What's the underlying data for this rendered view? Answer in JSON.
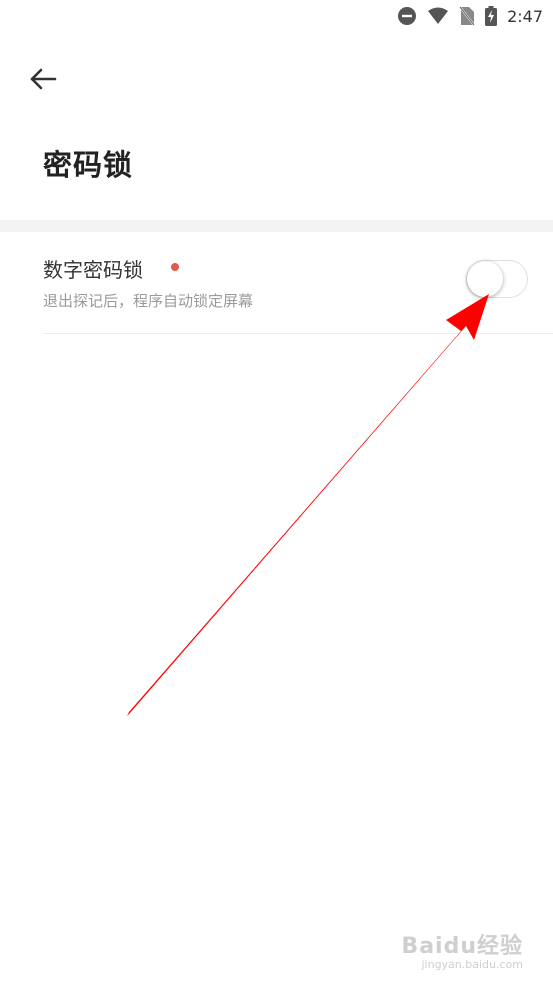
{
  "status_bar": {
    "time": "2:47",
    "icons": [
      "dnd-icon",
      "wifi-icon",
      "no-sim-icon",
      "battery-charging-icon"
    ]
  },
  "header": {
    "back_icon": "arrow-left-icon",
    "title": "密码锁"
  },
  "setting": {
    "title": "数字密码锁",
    "description": "退出探记后，程序自动锁定屏幕",
    "toggle_on": false
  },
  "watermark": {
    "logo": "Baidu经验",
    "url": "jingyan.baidu.com"
  },
  "colors": {
    "arrow": "#ff0000",
    "dot": "#e5584a",
    "band": "#f3f3f3"
  }
}
